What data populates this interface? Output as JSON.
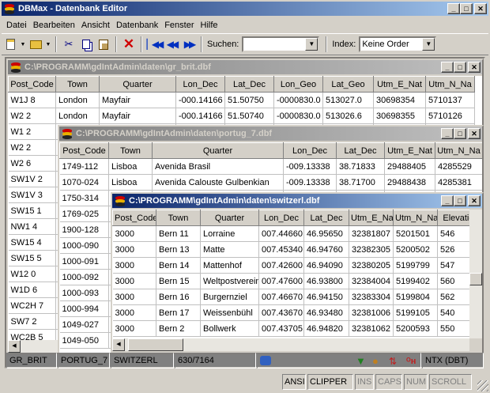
{
  "app": {
    "title": "DBMax - Datenbank Editor"
  },
  "menu": [
    "Datei",
    "Bearbeiten",
    "Ansicht",
    "Datenbank",
    "Fenster",
    "Hilfe"
  ],
  "toolbar": {
    "search_label": "Suchen:",
    "search_value": "",
    "index_label": "Index:",
    "index_value": "Keine Order",
    "icons": [
      "new-file-icon",
      "open-folder-icon",
      "cut-icon",
      "copy-icon",
      "paste-icon",
      "delete-icon",
      "first-record-icon",
      "prev-record-icon",
      "next-record-icon"
    ]
  },
  "windows": {
    "gr_brit": {
      "title": "C:\\PROGRAMM\\gdIntAdmin\\daten\\gr_brit.dbf",
      "columns": [
        "Post_Code",
        "Town",
        "Quarter",
        "Lon_Dec",
        "Lat_Dec",
        "Lon_Geo",
        "Lat_Geo",
        "Utm_E_Nat",
        "Utm_N_Na"
      ],
      "rows": [
        [
          "W1J 8",
          "London",
          "Mayfair",
          "-000.14166",
          "51.50750",
          "-0000830.0",
          "513027.0",
          "30698354",
          "5710137"
        ],
        [
          "W2 2",
          "London",
          "Mayfair",
          "-000.14166",
          "51.50740",
          "-0000830.0",
          "513026.6",
          "30698355",
          "5710126"
        ],
        [
          "W1 2",
          "",
          "",
          "",
          "",
          "",
          "",
          "",
          ""
        ],
        [
          "W2 2",
          "",
          "",
          "",
          "",
          "",
          "",
          "",
          ""
        ],
        [
          "W2 6",
          "",
          "",
          "",
          "",
          "",
          "",
          "",
          ""
        ],
        [
          "SW1V 2",
          "",
          "",
          "",
          "",
          "",
          "",
          "",
          ""
        ],
        [
          "SW1V 3",
          "",
          "",
          "",
          "",
          "",
          "",
          "",
          ""
        ],
        [
          "SW15 1",
          "",
          "",
          "",
          "",
          "",
          "",
          "",
          ""
        ],
        [
          "NW1 4",
          "",
          "",
          "",
          "",
          "",
          "",
          "",
          ""
        ],
        [
          "SW15 4",
          "",
          "",
          "",
          "",
          "",
          "",
          "",
          ""
        ],
        [
          "SW15 5",
          "",
          "",
          "",
          "",
          "",
          "",
          "",
          ""
        ],
        [
          "W12 0",
          "",
          "",
          "",
          "",
          "",
          "",
          "",
          ""
        ],
        [
          "W1D 6",
          "",
          "",
          "",
          "",
          "",
          "",
          "",
          ""
        ],
        [
          "WC2H 7",
          "",
          "",
          "",
          "",
          "",
          "",
          "",
          ""
        ],
        [
          "SW7 2",
          "",
          "",
          "",
          "",
          "",
          "",
          "",
          ""
        ],
        [
          "WC2B 5",
          "",
          "",
          "",
          "",
          "",
          "",
          "",
          ""
        ]
      ],
      "status": "GR_BRIT"
    },
    "portug": {
      "title": "C:\\PROGRAMM\\gdIntAdmin\\daten\\portug_7.dbf",
      "columns": [
        "Post_Code",
        "Town",
        "Quarter",
        "Lon_Dec",
        "Lat_Dec",
        "Utm_E_Nat",
        "Utm_N_Na"
      ],
      "rows": [
        [
          "1749-112",
          "Lisboa",
          "Avenida Brasil",
          "-009.13338",
          "38.71833",
          "29488405",
          "4285529"
        ],
        [
          "1070-024",
          "Lisboa",
          "Avenida Calouste Gulbenkian",
          "-009.13338",
          "38.71700",
          "29488438",
          "4285381"
        ],
        [
          "1750-314",
          "",
          "",
          "",
          "",
          "",
          ""
        ],
        [
          "1769-025",
          "",
          "",
          "",
          "",
          "",
          ""
        ],
        [
          "1900-128",
          "",
          "",
          "",
          "",
          "",
          ""
        ],
        [
          "1000-090",
          "",
          "",
          "",
          "",
          "",
          ""
        ],
        [
          "1000-091",
          "",
          "",
          "",
          "",
          "",
          ""
        ],
        [
          "1000-092",
          "",
          "",
          "",
          "",
          "",
          ""
        ],
        [
          "1000-093",
          "",
          "",
          "",
          "",
          "",
          ""
        ],
        [
          "1000-994",
          "",
          "",
          "",
          "",
          "",
          ""
        ],
        [
          "1049-027",
          "",
          "",
          "",
          "",
          "",
          ""
        ],
        [
          "1049-050",
          "",
          "",
          "",
          "",
          "",
          ""
        ]
      ],
      "status": "PORTUG_7"
    },
    "switzerl": {
      "title": "C:\\PROGRAMM\\gdIntAdmin\\daten\\switzerl.dbf",
      "columns": [
        "Post_Code",
        "Town",
        "Quarter",
        "Lon_Dec",
        "Lat_Dec",
        "Utm_E_Nat",
        "Utm_N_Na",
        "Elevation"
      ],
      "rows": [
        [
          "3000",
          "Bern 11",
          "Lorraine",
          "007.44660",
          "46.95650",
          "32381807",
          "5201501",
          "546"
        ],
        [
          "3000",
          "Bern 13",
          "Matte",
          "007.45340",
          "46.94760",
          "32382305",
          "5200502",
          "526"
        ],
        [
          "3000",
          "Bern 14",
          "Mattenhof",
          "007.42600",
          "46.94090",
          "32380205",
          "5199799",
          "547"
        ],
        [
          "3000",
          "Bern 15",
          "Weltpostverein",
          "007.47600",
          "46.93800",
          "32384004",
          "5199402",
          "560"
        ],
        [
          "3000",
          "Bern 16",
          "Burgernziel",
          "007.46670",
          "46.94150",
          "32383304",
          "5199804",
          "562"
        ],
        [
          "3000",
          "Bern 17",
          "Weissenbühl",
          "007.43670",
          "46.93480",
          "32381006",
          "5199105",
          "540"
        ],
        [
          "3000",
          "Bern 2",
          "Bollwerk",
          "007.43705",
          "46.94820",
          "32381062",
          "5200593",
          "550"
        ]
      ],
      "status": "SWITZERL",
      "record": "630/7164",
      "driver": "NTX (DBT)"
    }
  },
  "statusbar": [
    "ANSI",
    "CLIPPER",
    "INS",
    "CAPS",
    "NUM",
    "SCROLL"
  ],
  "colors": {
    "active_title": "#0a246a",
    "inactive_title": "#808080",
    "face": "#d4d0c8"
  }
}
